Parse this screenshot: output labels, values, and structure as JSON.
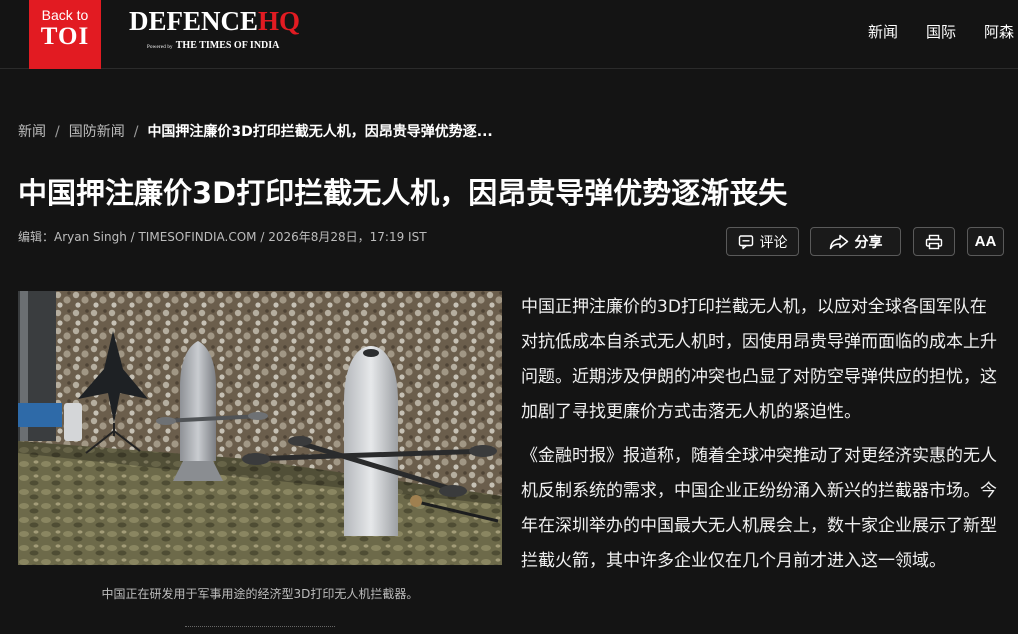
{
  "header": {
    "back_label": "Back to",
    "back_brand": "TOI",
    "brand_main": "DEFENCE",
    "brand_accent": "HQ",
    "powered_by": "Powered by",
    "powered_brand": "THE TIMES OF INDIA",
    "nav": [
      "新闻",
      "国际",
      "阿森"
    ]
  },
  "breadcrumb": {
    "items": [
      "新闻",
      "国防新闻"
    ],
    "current": "中国押注廉价3D打印拦截无人机，因昂贵导弹优势逐...",
    "separator": "/"
  },
  "article": {
    "title": "中国押注廉价3D打印拦截无人机，因昂贵导弹优势逐渐丧失",
    "byline": "编辑：Aryan Singh / TIMESOFINDIA.COM / 2026年8月28日，17:19 IST",
    "image_caption": "中国正在研发用于军事用途的经济型3D打印无人机拦截器。",
    "paragraphs": [
      "中国正押注廉价的3D打印拦截无人机，以应对全球各国军队在对抗低成本自杀式无人机时，因使用昂贵导弹而面临的成本上升问题。近期涉及伊朗的冲突也凸显了对防空导弹供应的担忧，这加剧了寻找更廉价方式击落无人机的紧迫性。",
      "《金融时报》报道称，随着全球冲突推动了对更经济实惠的无人机反制系统的需求，中国企业正纷纷涌入新兴的拦截器市场。今年在深圳举办的中国最大无人机展会上，数十家企业展示了新型拦截火箭，其中许多企业仅在几个月前才进入这一领域。"
    ]
  },
  "actions": {
    "comment": "评论",
    "share": "分享",
    "font_size": "AA"
  },
  "icons": [
    "comment-icon",
    "share-icon",
    "print-icon"
  ],
  "colors": {
    "brand_red": "#e21b22",
    "background": "#141414",
    "text": "#ffffff",
    "muted": "#bdbdbd"
  }
}
